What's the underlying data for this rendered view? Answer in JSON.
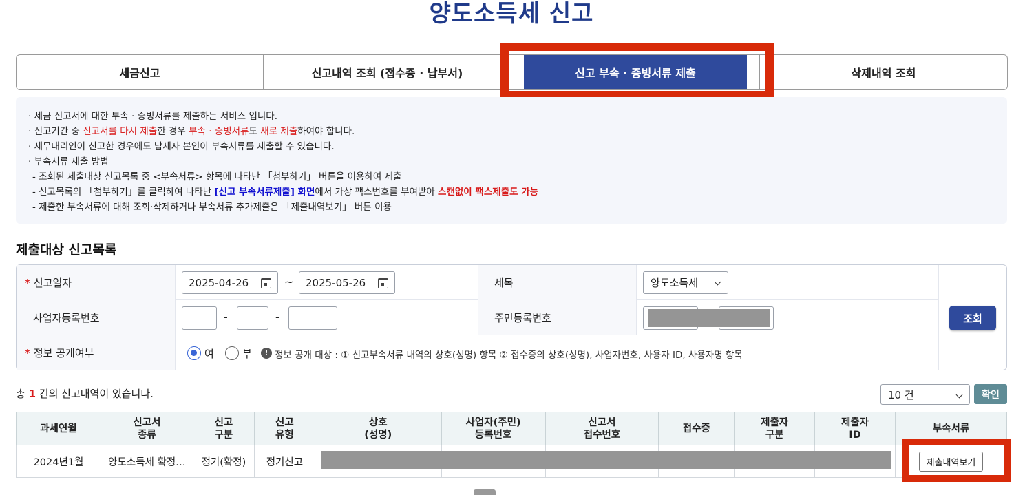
{
  "page_title": "양도소득세 신고",
  "tabs": [
    {
      "label": "세금신고"
    },
    {
      "label": "신고내역 조회 (접수증 · 납부서)"
    },
    {
      "label": "신고 부속 · 증빙서류 제출"
    },
    {
      "label": "삭제내역 조회"
    }
  ],
  "notice": {
    "l1": "· 세금 신고서에 대한 부속 · 증빙서류를 제출하는 서비스 입니다.",
    "l2a": "· 신고기간 중 ",
    "l2b": "신고서를 다시 제출",
    "l2c": "한 경우 ",
    "l2d": "부속 · 증빙서류",
    "l2e": "도 ",
    "l2f": "새로 제출",
    "l2g": "하여야 합니다.",
    "l3": "· 세무대리인이 신고한 경우에도 납세자 본인이 부속서류를 제출할 수 있습니다.",
    "l4": "· 부속서류 제출 방법",
    "l5": "- 조회된 제출대상 신고목록 중 <부속서류> 항목에 나타난 「첨부하기」 버튼을 이용하여 제출",
    "l6a": "- 신고목록의 「첨부하기」를 클릭하여 나타난 ",
    "l6b": "[신고 부속서류제출] 화면",
    "l6c": "에서 가상 팩스번호를 부여받아 ",
    "l6d": "스캔없이 팩스제출도 가능",
    "l7": "- 제출한 부속서류에 대해 조회·삭제하거나 부속서류 추가제출은 「제출내역보기」 버튼 이용"
  },
  "section_title": "제출대상 신고목록",
  "filter": {
    "report_date_label": "신고일자",
    "date_from": "2025-04-26",
    "date_sep": "~",
    "date_to": "2025-05-26",
    "tax_item_label": "세목",
    "tax_item_value": "양도소득세",
    "biz_no_label": "사업자등록번호",
    "dash": "-",
    "resident_no_label": "주민등록번호",
    "disclosure_label": "정보 공개여부",
    "yes_label": "여",
    "no_label": "부",
    "disclosure_note": "정보 공개 대상 : ① 신고부속서류 내역의 상호(성명) 항목 ② 접수증의 상호(성명), 사업자번호, 사용자 ID, 사용자명 항목",
    "search_button": "조회"
  },
  "result": {
    "total_prefix": "총 ",
    "total_count": "1",
    "total_suffix": " 건의 신고내역이 있습니다.",
    "page_size": "10 건",
    "confirm_button": "확인",
    "columns": [
      "과세연월",
      "신고서\n종류",
      "신고\n구분",
      "신고\n유형",
      "상호\n(성명)",
      "사업자(주민)\n등록번호",
      "신고서\n접수번호",
      "접수증",
      "제출자\n구분",
      "제출자\nID",
      "부속서류"
    ],
    "rows": [
      {
        "period": "2024년1월",
        "kind": "양도소득세 확정…",
        "category": "정기(확정)",
        "type": "정기신고",
        "action": "제출내역보기"
      }
    ]
  },
  "colors": {
    "primary": "#2f4a9c",
    "highlight": "#d82a09",
    "alert": "#d81b1b"
  }
}
